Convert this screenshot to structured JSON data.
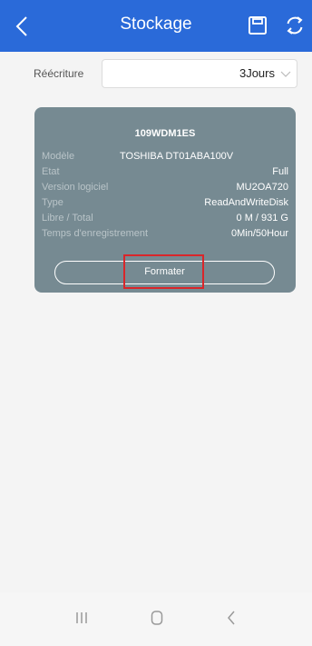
{
  "header": {
    "title": "Stockage",
    "back_icon": "chevron-left-icon",
    "save_icon": "floppy-disk-icon",
    "refresh_icon": "refresh-icon",
    "background": "#2a6ad9"
  },
  "rewrite": {
    "label": "Réécriture",
    "selected_value": "3Jours"
  },
  "disk": {
    "id": "109WDM1ES",
    "rows": [
      {
        "label": "Modèle",
        "value": "TOSHIBA DT01ABA100V"
      },
      {
        "label": "Etat",
        "value": "Full"
      },
      {
        "label": "Version logiciel",
        "value": "MU2OA720"
      },
      {
        "label": "Type",
        "value": "ReadAndWriteDisk"
      },
      {
        "label": "Libre / Total",
        "value": "0 M / 931 G"
      },
      {
        "label": "Temps d'enregistrement",
        "value": "0Min/50Hour"
      }
    ],
    "format_button": "Formater",
    "card_color": "#768a92",
    "highlight_color": "#d9262a"
  },
  "navbar": {
    "recent_icon": "recent-apps-icon",
    "home_icon": "home-icon",
    "back_icon": "back-icon"
  }
}
